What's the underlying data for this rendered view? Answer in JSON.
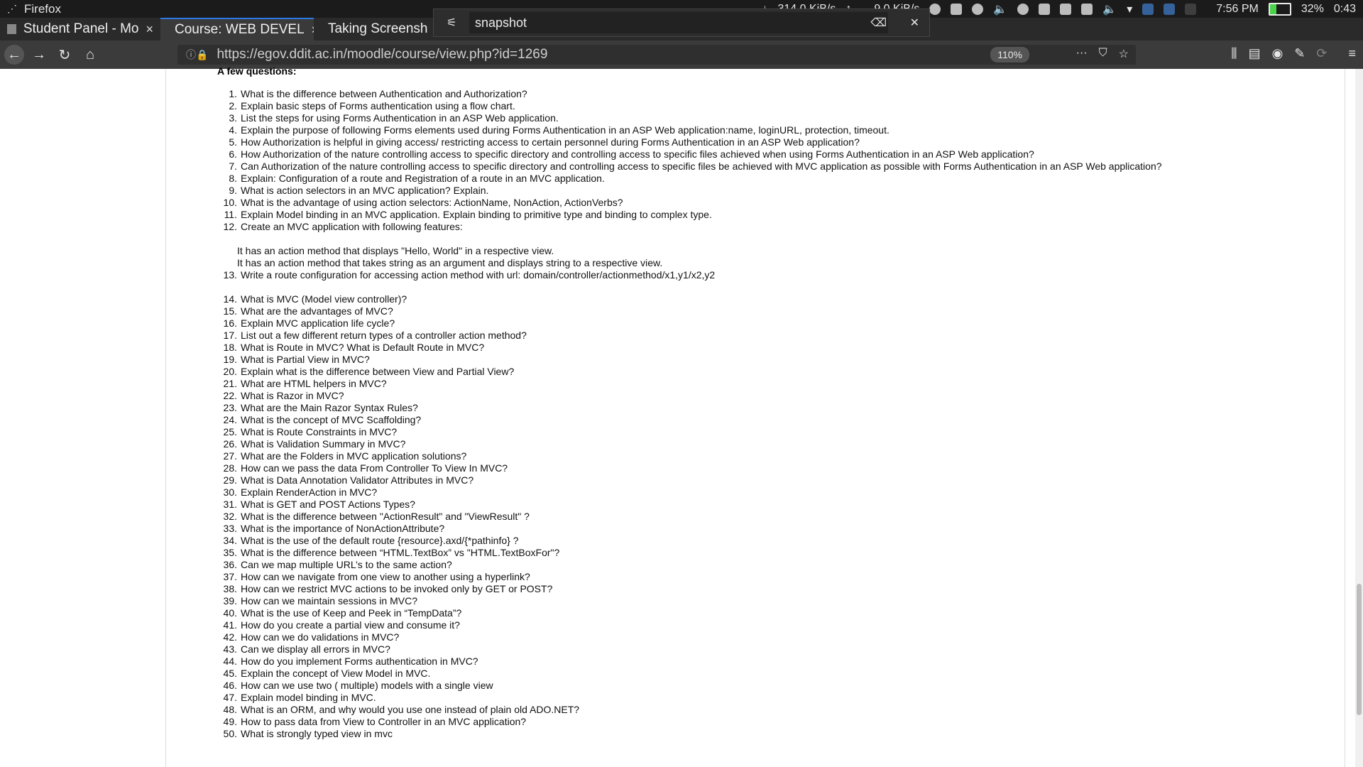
{
  "system_bar": {
    "app_name": "Firefox",
    "download_rate": "314.0 KiB/s",
    "upload_rate": "9.0 KiB/s",
    "clock": "7:56 PM",
    "battery": "32%",
    "battery_time": "0:43"
  },
  "tabs": [
    {
      "label": "Student Panel - Mo",
      "active": false
    },
    {
      "label": "Course: WEB DEVEL",
      "active": true
    },
    {
      "label": "Taking Screensh",
      "active": false
    }
  ],
  "snapshot_overlay": {
    "query": "snapshot"
  },
  "navbar": {
    "url": "https://egov.ddit.ac.in/moodle/course/view.php?id=1269",
    "zoom": "110%"
  },
  "content": {
    "heading": "A few questions:",
    "questions": [
      {
        "n": "1.",
        "text": "What is the difference between Authentication and Authorization?"
      },
      {
        "n": "2.",
        "text": "Explain basic steps of Forms authentication using a flow chart."
      },
      {
        "n": "3.",
        "text": "List the steps for using Forms Authentication in an ASP Web application."
      },
      {
        "n": "4.",
        "text": "Explain the purpose of following Forms elements used during Forms Authentication in an ASP Web application:name, loginURL, protection, timeout."
      },
      {
        "n": "5.",
        "text": "How Authorization is helpful in giving access/ restricting access to certain personnel during Forms Authentication in an ASP Web application?"
      },
      {
        "n": "6.",
        "text": "How Authorization of the nature controlling access to specific directory and controlling access to specific files achieved when using Forms Authentication in an ASP Web application?"
      },
      {
        "n": "7.",
        "text": "Can Authorization of the nature controlling access to specific directory and controlling access to specific files be achieved with MVC application as possible with Forms Authentication in an ASP Web application?"
      },
      {
        "n": "8.",
        "text": "Explain: Configuration of a route and Registration of a route in an MVC application."
      },
      {
        "n": "9.",
        "text": "What is action selectors in an MVC application? Explain."
      },
      {
        "n": "10.",
        "text": "What is the advantage of using action selectors: ActionName, NonAction, ActionVerbs?"
      },
      {
        "n": "11.",
        "text": "Explain Model binding in an MVC application. Explain binding to primitive type and binding to complex type."
      },
      {
        "n": "12.",
        "text": "Create an MVC application with following features:"
      }
    ],
    "q12_notes": [
      "It has an action method that displays \"Hello, World\" in a respective view.",
      "It has an action method that takes string as an argument and displays string to a respective view."
    ],
    "q13": {
      "n": "13.",
      "text": "Write a route configuration for accessing action method with url: domain/controller/actionmethod/x1,y1/x2,y2"
    },
    "questions_b": [
      {
        "n": "14.",
        "text": "What is MVC (Model view controller)?"
      },
      {
        "n": "15.",
        "text": "What are the advantages of MVC?"
      },
      {
        "n": "16.",
        "text": "Explain MVC application life cycle?"
      },
      {
        "n": "17.",
        "text": "List out a few different return types of a controller action method?"
      },
      {
        "n": "18.",
        "text": "What is Route in MVC? What is Default Route in MVC?"
      },
      {
        "n": "19.",
        "text": "What is Partial View in MVC?"
      },
      {
        "n": "20.",
        "text": "Explain what is the difference between View and Partial View?"
      },
      {
        "n": "21.",
        "text": "What are HTML helpers in MVC?"
      },
      {
        "n": "22.",
        "text": "What is Razor in MVC?"
      },
      {
        "n": "23.",
        "text": "What are the Main Razor Syntax Rules?"
      },
      {
        "n": "24.",
        "text": "What is the concept of MVC Scaffolding?"
      },
      {
        "n": "25.",
        "text": "What is Route Constraints in MVC?"
      },
      {
        "n": "26.",
        "text": "What is Validation Summary in MVC?"
      },
      {
        "n": "27.",
        "text": "What are the Folders in MVC application solutions?"
      },
      {
        "n": "28.",
        "text": "How can we pass the data From Controller To View In MVC?"
      },
      {
        "n": "29.",
        "text": "What is Data Annotation Validator Attributes in MVC?"
      },
      {
        "n": "30.",
        "text": "Explain RenderAction in MVC?"
      },
      {
        "n": "31.",
        "text": "What is GET and POST Actions Types?"
      },
      {
        "n": "32.",
        "text": "What is the difference between \"ActionResult\" and \"ViewResult\" ?"
      },
      {
        "n": "33.",
        "text": "What is the importance of NonActionAttribute?"
      },
      {
        "n": "34.",
        "text": "What is the use of the default route {resource}.axd/{*pathinfo} ?"
      },
      {
        "n": "35.",
        "text": "What is the difference between “HTML.TextBox” vs \"HTML.TextBoxFor\"?"
      },
      {
        "n": "36.",
        "text": "Can we map multiple URL’s to the same action?"
      },
      {
        "n": "37.",
        "text": "How can we navigate from one view to another using a hyperlink?"
      },
      {
        "n": "38.",
        "text": "How can we restrict MVC actions to be invoked only by GET or POST?"
      },
      {
        "n": "39.",
        "text": "How can we maintain sessions in MVC?"
      },
      {
        "n": "40.",
        "text": "What is the use of Keep and Peek in “TempData”?"
      },
      {
        "n": "41.",
        "text": "How do you create a partial view and consume it?"
      },
      {
        "n": "42.",
        "text": "How can we do validations in MVC?"
      },
      {
        "n": "43.",
        "text": "Can we display all errors in MVC?"
      },
      {
        "n": "44.",
        "text": "How do you implement Forms authentication in MVC?"
      },
      {
        "n": "45.",
        "text": "Explain the concept of View Model in MVC."
      },
      {
        "n": "46.",
        "text": "How can we use two ( multiple) models with a single view"
      },
      {
        "n": "47.",
        "text": "Explain model binding in MVC."
      },
      {
        "n": "48.",
        "text": "What is an ORM, and why would you use one instead of plain old ADO.NET?"
      },
      {
        "n": "49.",
        "text": "How to pass data from View to Controller in an MVC application?"
      },
      {
        "n": "50.",
        "text": "What is strongly typed view in mvc"
      }
    ]
  }
}
